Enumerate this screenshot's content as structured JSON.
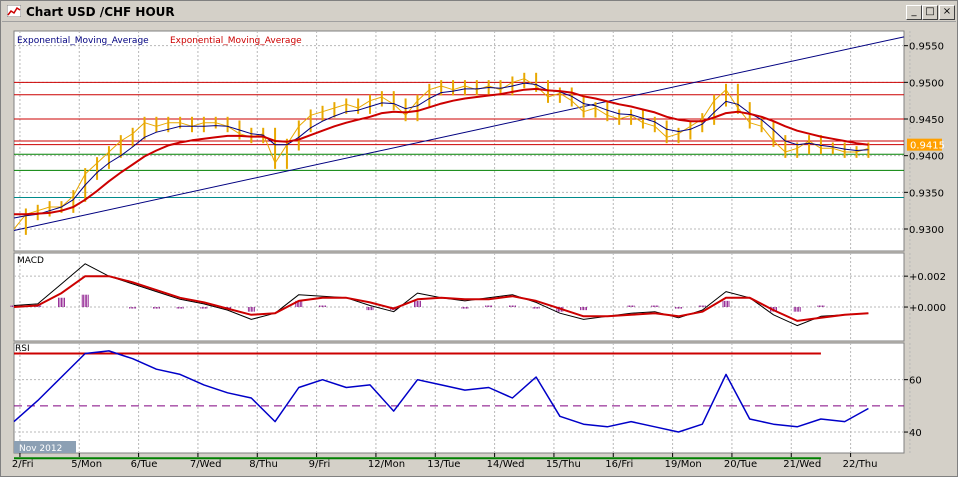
{
  "window": {
    "title": "Chart USD /CHF  HOUR",
    "buttons": {
      "minimize": "_",
      "maximize": "□",
      "close": "×"
    }
  },
  "colors": {
    "background": "#ffffff",
    "frame": "#d4d0c8",
    "price": "#e8a800",
    "ema_fast": "#000080",
    "ema_slow": "#cc0000",
    "trendline": "#000080",
    "level_red": "#cc0000",
    "level_green": "#008000",
    "level_cyan": "#008b8b",
    "histogram": "#800080",
    "rsi": "#0000c8",
    "rsi_overbought": "#ff00ff",
    "price_tag": "#ffa000"
  },
  "chart_data": [
    {
      "type": "line",
      "panel": "price",
      "title": "Chart USD /CHF  HOUR",
      "legend": [
        "Exponential_Moving_Average",
        "Exponential_Moving_Average"
      ],
      "legend_placement": "top-left",
      "ylim": [
        0.927,
        0.957
      ],
      "yticks": [
        0.93,
        0.935,
        0.94,
        0.945,
        0.95,
        0.955
      ],
      "ytick_labels": [
        "0.9300",
        "0.9350",
        "0.9400",
        "0.9450",
        "0.9500",
        "0.9550"
      ],
      "last_price_label": "0.9415",
      "last_price": 0.9415,
      "grid": true,
      "x": [
        0,
        4,
        8,
        12,
        16,
        20,
        24,
        28,
        32,
        36,
        40,
        44,
        48,
        52,
        56,
        60,
        64,
        68,
        72,
        76,
        80,
        84,
        88,
        92,
        96,
        100,
        104,
        108,
        112,
        116,
        120,
        124,
        128,
        132,
        136,
        140,
        144,
        148,
        152,
        156,
        160,
        164,
        168,
        172,
        176,
        180,
        184,
        188,
        192,
        196,
        200,
        204,
        208,
        212,
        216,
        220,
        224,
        228,
        232,
        236,
        240,
        244,
        248,
        252,
        256,
        260,
        264,
        268,
        272,
        276,
        280,
        284,
        288
      ],
      "series": [
        {
          "name": "",
          "role": "close",
          "values": [
            0.93,
            0.932,
            0.9325,
            0.933,
            0.933,
            0.9345,
            0.9375,
            0.939,
            0.9405,
            0.942,
            0.943,
            0.9445,
            0.944,
            0.9445,
            0.9445,
            0.944,
            0.9445,
            0.9445,
            0.944,
            0.943,
            0.9425,
            0.943,
            0.939,
            0.9415,
            0.944,
            0.9455,
            0.946,
            0.9465,
            0.947,
            0.9465,
            0.9475,
            0.948,
            0.947,
            0.9455,
            0.9475,
            0.949,
            0.9495,
            0.949,
            0.9495,
            0.949,
            0.9495,
            0.949,
            0.95,
            0.9505,
            0.9495,
            0.948,
            0.9485,
            0.9475,
            0.946,
            0.9465,
            0.9455,
            0.945,
            0.9455,
            0.9445,
            0.944,
            0.9425,
            0.943,
            0.944,
            0.945,
            0.9475,
            0.949,
            0.9465,
            0.9445,
            0.944,
            0.942,
            0.9405,
            0.941,
            0.942,
            0.941,
            0.941,
            0.9405,
            0.9405,
            0.941
          ]
        },
        {
          "name": "",
          "role": "ema_fast",
          "values": [
            0.9315,
            0.9318,
            0.932,
            0.9325,
            0.933,
            0.934,
            0.936,
            0.9377,
            0.939,
            0.94,
            0.9412,
            0.9425,
            0.9432,
            0.9436,
            0.944,
            0.944,
            0.944,
            0.9441,
            0.944,
            0.9435,
            0.943,
            0.9428,
            0.9415,
            0.9415,
            0.9425,
            0.9438,
            0.9447,
            0.9454,
            0.946,
            0.9462,
            0.9467,
            0.9472,
            0.9471,
            0.9464,
            0.9468,
            0.9478,
            0.9486,
            0.9488,
            0.9491,
            0.9491,
            0.9493,
            0.9492,
            0.9495,
            0.9499,
            0.9497,
            0.9489,
            0.9487,
            0.9481,
            0.9471,
            0.9468,
            0.9462,
            0.9457,
            0.9456,
            0.9451,
            0.9446,
            0.9436,
            0.9433,
            0.9436,
            0.9443,
            0.9459,
            0.9474,
            0.947,
            0.9458,
            0.9449,
            0.9435,
            0.942,
            0.9415,
            0.9417,
            0.9414,
            0.9412,
            0.9409,
            0.9407,
            0.9408
          ]
        },
        {
          "name": "",
          "role": "ema_slow",
          "values": [
            0.932,
            0.932,
            0.9321,
            0.9322,
            0.9325,
            0.933,
            0.934,
            0.9352,
            0.9365,
            0.9377,
            0.9388,
            0.9399,
            0.9407,
            0.9414,
            0.9418,
            0.9421,
            0.9423,
            0.9425,
            0.9427,
            0.9427,
            0.9426,
            0.9426,
            0.942,
            0.9419,
            0.9422,
            0.9428,
            0.9434,
            0.944,
            0.9445,
            0.9449,
            0.9453,
            0.9458,
            0.946,
            0.9459,
            0.9461,
            0.9466,
            0.9471,
            0.9475,
            0.9478,
            0.948,
            0.9482,
            0.9484,
            0.9487,
            0.949,
            0.9491,
            0.9489,
            0.9488,
            0.9486,
            0.9481,
            0.9478,
            0.9474,
            0.947,
            0.9467,
            0.9463,
            0.9459,
            0.9453,
            0.9449,
            0.9447,
            0.9447,
            0.9452,
            0.9458,
            0.946,
            0.9457,
            0.9453,
            0.9447,
            0.944,
            0.9434,
            0.943,
            0.9426,
            0.9423,
            0.942,
            0.9417,
            0.9415
          ]
        }
      ],
      "horizontal_levels": [
        {
          "value": 0.95,
          "color": "#cc0000"
        },
        {
          "value": 0.9483,
          "color": "#cc0000"
        },
        {
          "value": 0.945,
          "color": "#cc0000"
        },
        {
          "value": 0.942,
          "color": "#cc0000"
        },
        {
          "value": 0.9415,
          "color": "#cc0000"
        },
        {
          "value": 0.9402,
          "color": "#008000"
        },
        {
          "value": 0.938,
          "color": "#008000"
        },
        {
          "value": 0.9343,
          "color": "#008b8b"
        }
      ],
      "trendline": {
        "x": [
          0,
          300
        ],
        "values": [
          0.9298,
          0.9562
        ]
      }
    },
    {
      "type": "line",
      "panel": "macd",
      "title": "MACD",
      "ylim": [
        -0.0022,
        0.0035
      ],
      "yticks": [
        0.002,
        0.0
      ],
      "ytick_labels": [
        "+0.002",
        "+0.000"
      ],
      "x": [
        0,
        8,
        16,
        24,
        32,
        40,
        48,
        56,
        64,
        72,
        80,
        88,
        96,
        104,
        112,
        120,
        128,
        136,
        144,
        152,
        160,
        168,
        176,
        184,
        192,
        200,
        208,
        216,
        224,
        232,
        240,
        248,
        256,
        264,
        272,
        280,
        288
      ],
      "series": [
        {
          "name": "",
          "role": "macd",
          "values": [
            0.0001,
            0.0002,
            0.0015,
            0.0028,
            0.002,
            0.0015,
            0.001,
            0.0005,
            0.0002,
            -0.0002,
            -0.0008,
            -0.0004,
            0.0008,
            0.0007,
            0.0006,
            0.0001,
            -0.0003,
            0.0009,
            0.0006,
            0.0004,
            0.0006,
            0.0008,
            0.0003,
            -0.0004,
            -0.0008,
            -0.0006,
            -0.0004,
            -0.0003,
            -0.0007,
            -0.0002,
            0.001,
            0.0006,
            -0.0005,
            -0.0012,
            -0.0006,
            -0.0005,
            -0.0004
          ]
        },
        {
          "name": "",
          "role": "signal",
          "values": [
            0.0,
            0.0001,
            0.0009,
            0.002,
            0.002,
            0.0016,
            0.0011,
            0.0006,
            0.0003,
            -0.0001,
            -0.0005,
            -0.0004,
            0.0004,
            0.0006,
            0.0006,
            0.0003,
            -0.0001,
            0.0005,
            0.0006,
            0.0005,
            0.0005,
            0.0007,
            0.0004,
            -0.0001,
            -0.0006,
            -0.0006,
            -0.0005,
            -0.0004,
            -0.0006,
            -0.0003,
            0.0006,
            0.0006,
            -0.0002,
            -0.0009,
            -0.0007,
            -0.0005,
            -0.0004
          ]
        },
        {
          "name": "",
          "role": "histogram",
          "values": [
            0.0001,
            0.0001,
            0.0006,
            0.0008,
            0.0,
            -0.0001,
            -0.0001,
            -0.0001,
            -0.0001,
            -0.0001,
            -0.0003,
            0.0,
            0.0004,
            0.0001,
            0.0,
            -0.0002,
            -0.0002,
            0.0004,
            0.0,
            -0.0001,
            0.0001,
            0.0001,
            -0.0001,
            -0.0003,
            -0.0002,
            0.0,
            0.0001,
            0.0001,
            -0.0001,
            0.0001,
            0.0004,
            0.0,
            -0.0003,
            -0.0003,
            0.0001,
            0.0,
            0.0
          ]
        }
      ]
    },
    {
      "type": "line",
      "panel": "rsi",
      "title": "RSI",
      "ylim": [
        32,
        74
      ],
      "yticks": [
        60,
        40
      ],
      "ytick_labels": [
        "60",
        "40"
      ],
      "levels": [
        {
          "value": 70,
          "color": "#cc0000"
        },
        {
          "value": 50,
          "color": "#800080",
          "style": "dashed"
        },
        {
          "value": 30,
          "color": "#008000"
        }
      ],
      "x": [
        0,
        8,
        16,
        24,
        32,
        40,
        48,
        56,
        64,
        72,
        80,
        88,
        96,
        104,
        112,
        120,
        128,
        136,
        144,
        152,
        160,
        168,
        176,
        184,
        192,
        200,
        208,
        216,
        224,
        232,
        240,
        248,
        256,
        264,
        272,
        280,
        288
      ],
      "series": [
        {
          "name": "",
          "role": "rsi",
          "values": [
            44,
            52,
            61,
            70,
            71,
            68,
            64,
            62,
            58,
            55,
            53,
            44,
            57,
            60,
            57,
            58,
            48,
            60,
            58,
            56,
            57,
            53,
            61,
            46,
            43,
            42,
            44,
            42,
            40,
            43,
            62,
            45,
            43,
            42,
            45,
            44,
            49
          ]
        }
      ],
      "date_label": "Nov 2012",
      "x_tick_positions": [
        2,
        22,
        42,
        62,
        82,
        102,
        122,
        142,
        162,
        182,
        202,
        222,
        242,
        262,
        282,
        302
      ],
      "x_tick_labels": [
        "2/Fri",
        "5/Mon",
        "6/Tue",
        "7/Wed",
        "8/Thu",
        "9/Fri",
        "12/Mon",
        "13/Tue",
        "14/Wed",
        "15/Thu",
        "16/Fri",
        "19/Mon",
        "20/Tue",
        "21/Wed",
        "22/Thu"
      ]
    }
  ]
}
